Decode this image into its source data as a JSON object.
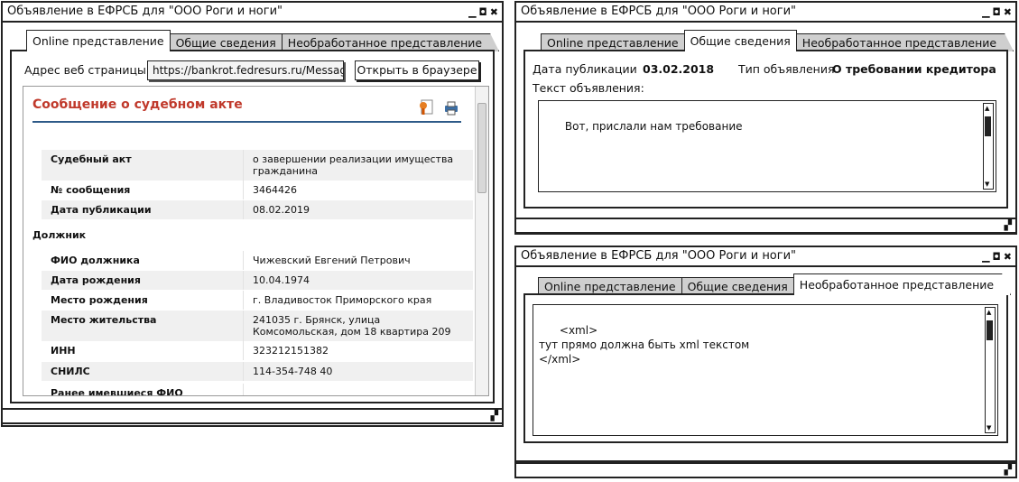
{
  "window_title": "Объявление в ЕФРСБ для \"ООО Роги и ноги\"",
  "tabs": [
    "Online представление",
    "Общие сведения",
    "Необработанное представление"
  ],
  "online": {
    "url_label": "Адрес веб страницы:",
    "url_value": "https://bankrot.fedresurs.ru/Messag",
    "open_button": "Открыть в браузере",
    "page": {
      "title": "Сообщение о судебном акте",
      "rows_top": [
        {
          "k": "Судебный акт",
          "v": "о завершении реализации имущества гражданина"
        },
        {
          "k": "№ сообщения",
          "v": "3464426"
        },
        {
          "k": "Дата публикации",
          "v": "08.02.2019"
        }
      ],
      "debtor_section": "Должник",
      "rows_debtor": [
        {
          "k": "ФИО должника",
          "v": "Чижевский Евгений Петрович"
        },
        {
          "k": "Дата рождения",
          "v": "10.04.1974"
        },
        {
          "k": "Место рождения",
          "v": "г. Владивосток Приморского края"
        },
        {
          "k": "Место жительства",
          "v": "241035 г. Брянск, улица Комсомольская, дом 18 квартира 209"
        },
        {
          "k": "ИНН",
          "v": "323212151382"
        },
        {
          "k": "СНИЛС",
          "v": "114-354-748 40"
        },
        {
          "k": "Ранее имевшиеся ФИО",
          "v": ""
        }
      ]
    }
  },
  "general": {
    "pub_date_label": "Дата публикации",
    "pub_date_value": "03.02.2018",
    "type_label": "Тип объявления",
    "type_value": "О требовании кредитора",
    "text_label": "Текст объявления:",
    "text_value": "Вот, прислали нам требование"
  },
  "raw": {
    "text_value": "<xml>\nтут прямо должна быть xml текстом\n</xml>"
  },
  "icons": {
    "minimize": "minimize-icon",
    "restore": "restore-icon",
    "close": "close-icon",
    "grip": "resize-grip-icon",
    "certificate": "certificate-icon",
    "print": "print-icon"
  }
}
